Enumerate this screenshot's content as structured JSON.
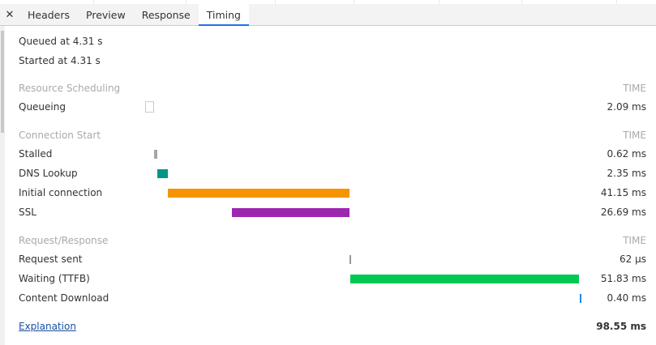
{
  "tabs": {
    "close_glyph": "✕",
    "items": [
      {
        "label": "Headers",
        "active": false
      },
      {
        "label": "Preview",
        "active": false
      },
      {
        "label": "Response",
        "active": false
      },
      {
        "label": "Timing",
        "active": true
      }
    ]
  },
  "summary": {
    "queued": "Queued at 4.31 s",
    "started": "Started at 4.31 s"
  },
  "sections": [
    {
      "title": "Resource Scheduling",
      "time_header": "TIME",
      "rows": [
        {
          "label": "Queueing",
          "value": "2.09 ms",
          "bar": {
            "start_ms": 0,
            "duration_ms": 2.09,
            "color": "#ffffff",
            "outline": "#cccccc"
          }
        }
      ]
    },
    {
      "title": "Connection Start",
      "time_header": "TIME",
      "rows": [
        {
          "label": "Stalled",
          "value": "0.62 ms",
          "bar": {
            "start_ms": 2.09,
            "duration_ms": 0.62,
            "color": "#a6a6a6"
          }
        },
        {
          "label": "DNS Lookup",
          "value": "2.35 ms",
          "bar": {
            "start_ms": 2.71,
            "duration_ms": 2.35,
            "color": "#009688"
          }
        },
        {
          "label": "Initial connection",
          "value": "41.15 ms",
          "bar": {
            "start_ms": 5.06,
            "duration_ms": 41.15,
            "color": "#f59300"
          }
        },
        {
          "label": "SSL",
          "value": "26.69 ms",
          "bar": {
            "start_ms": 19.52,
            "duration_ms": 26.69,
            "color": "#9c27b0"
          }
        }
      ]
    },
    {
      "title": "Request/Response",
      "time_header": "TIME",
      "rows": [
        {
          "label": "Request sent",
          "value": "62 μs",
          "bar": {
            "start_ms": 46.21,
            "duration_ms": 0.062,
            "color": "#999999"
          }
        },
        {
          "label": "Waiting (TTFB)",
          "value": "51.83 ms",
          "bar": {
            "start_ms": 46.27,
            "duration_ms": 51.83,
            "color": "#00c853"
          }
        },
        {
          "label": "Content Download",
          "value": "0.40 ms",
          "bar": {
            "start_ms": 98.1,
            "duration_ms": 0.4,
            "color": "#1e88e5"
          }
        }
      ]
    }
  ],
  "footer": {
    "explanation": "Explanation",
    "total": "98.55 ms"
  },
  "total_ms": 98.55
}
